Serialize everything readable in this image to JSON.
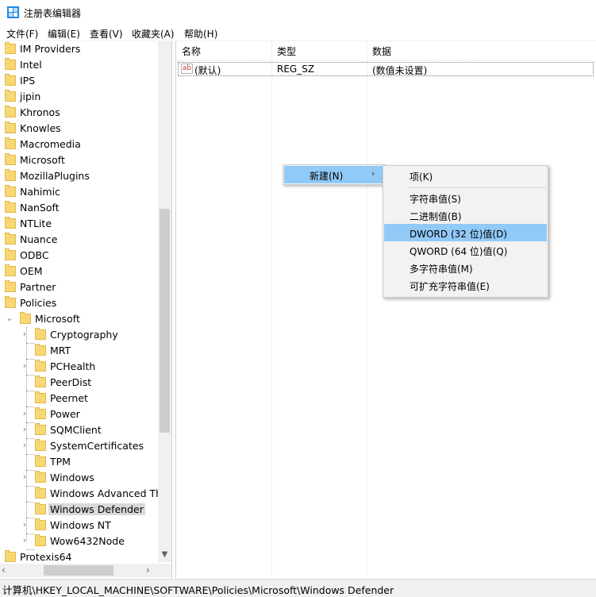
{
  "window": {
    "title": "注册表编辑器",
    "accent": "#91c9f7"
  },
  "menubar": {
    "items": [
      "文件(F)",
      "编辑(E)",
      "查看(V)",
      "收藏夹(A)",
      "帮助(H)"
    ]
  },
  "tree": {
    "top_items": [
      "IM Providers",
      "Intel",
      "IPS",
      "jipin",
      "Khronos",
      "Knowles",
      "Macromedia",
      "Microsoft",
      "MozillaPlugins",
      "Nahimic",
      "NanSoft",
      "NTLite",
      "Nuance",
      "ODBC",
      "OEM",
      "Partner",
      "Policies"
    ],
    "policies_child": "Microsoft",
    "microsoft_children": [
      {
        "label": "Cryptography",
        "expandable": true
      },
      {
        "label": "MRT",
        "expandable": false
      },
      {
        "label": "PCHealth",
        "expandable": true
      },
      {
        "label": "PeerDist",
        "expandable": false
      },
      {
        "label": "Peernet",
        "expandable": false
      },
      {
        "label": "Power",
        "expandable": true
      },
      {
        "label": "SQMClient",
        "expandable": true
      },
      {
        "label": "SystemCertificates",
        "expandable": true
      },
      {
        "label": "TPM",
        "expandable": false
      },
      {
        "label": "Windows",
        "expandable": true
      },
      {
        "label": "Windows Advanced Thr",
        "expandable": false
      },
      {
        "label": "Windows Defender",
        "expandable": false,
        "selected": true
      },
      {
        "label": "Windows NT",
        "expandable": true
      },
      {
        "label": "Wow6432Node",
        "expandable": true
      }
    ],
    "after_item": "Protexis64"
  },
  "list": {
    "headers": {
      "name": "名称",
      "type": "类型",
      "data": "数据"
    },
    "rows": [
      {
        "icon": "ab",
        "name": "(默认)",
        "type": "REG_SZ",
        "data": "(数值未设置)"
      }
    ]
  },
  "context_menu": {
    "new_label": "新建(N)",
    "submenu": [
      {
        "label": "项(K)"
      },
      {
        "label": "字符串值(S)"
      },
      {
        "label": "二进制值(B)"
      },
      {
        "label": "DWORD (32 位)值(D)",
        "highlighted": true
      },
      {
        "label": "QWORD (64 位)值(Q)"
      },
      {
        "label": "多字符串值(M)"
      },
      {
        "label": "可扩充字符串值(E)"
      }
    ]
  },
  "statusbar": {
    "path": "计算机\\HKEY_LOCAL_MACHINE\\SOFTWARE\\Policies\\Microsoft\\Windows Defender"
  }
}
